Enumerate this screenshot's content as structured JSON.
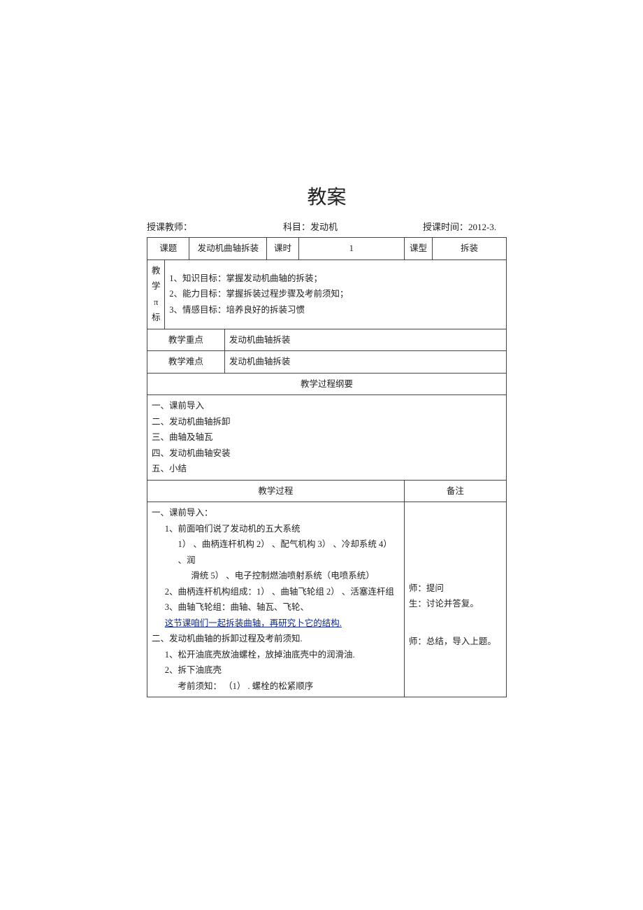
{
  "title": "教案",
  "meta": {
    "teacher_label": "授课教师：",
    "subject_label": "科目：",
    "subject_value": "发动机",
    "time_label": "授课时间：",
    "time_value": "2012-3."
  },
  "header_row": {
    "topic_label": "课题",
    "topic_value": "发动机曲轴拆装",
    "period_label": "课时",
    "period_value": "1",
    "type_label": "课型",
    "type_value": "拆装"
  },
  "goals": {
    "side_label": "教学\nπ\n标",
    "g1": "1、知识目标：掌握发动机曲轴的拆装；",
    "g2": "2、能力目标：掌握拆装过程步骤及考前须知；",
    "g3": "3、情感目标：培养良好的拆装习惯"
  },
  "key_point": {
    "label": "教学重点",
    "value": "发动机曲轴拆装"
  },
  "hard_point": {
    "label": "教学难点",
    "value": "发动机曲轴拆装"
  },
  "outline": {
    "header": "教学过程纲要",
    "items": [
      "一、课前导入",
      "二、发动机曲轴拆卸",
      "三、曲轴及轴瓦",
      "四、发动机曲轴安装",
      "五、小结"
    ]
  },
  "process": {
    "left_header": "教学过程",
    "right_header": "备注",
    "left_lines": [
      "一、课前导入：",
      "1、前面咱们说了发动机的五大系统",
      "1） 、曲柄连杆机构 2） 、配气机构 3） 、冷却系统 4） 、润",
      "滑统 5） 、电子控制燃油喷射系统（电喷系统）",
      "2、曲柄连杆机构组成：1） 、曲轴飞轮组 2） 、活塞连杆组",
      "3、曲轴飞轮组：曲轴、轴瓦、飞轮、",
      "这节课咱们一起拆装曲轴，再研究卜它的结构.",
      "二、发动机曲轴的拆卸过程及考前须知.",
      "1、松开油底壳放油螺栓，放掉油底壳中的润滑油.",
      "2、拆下油底壳",
      "考前须知： （1） . 螺栓的松紧顺序"
    ],
    "link_index": 6,
    "right_lines": [
      "师：提问",
      "生：讨论并答复。",
      "",
      "师：总结，导入上题。"
    ]
  }
}
